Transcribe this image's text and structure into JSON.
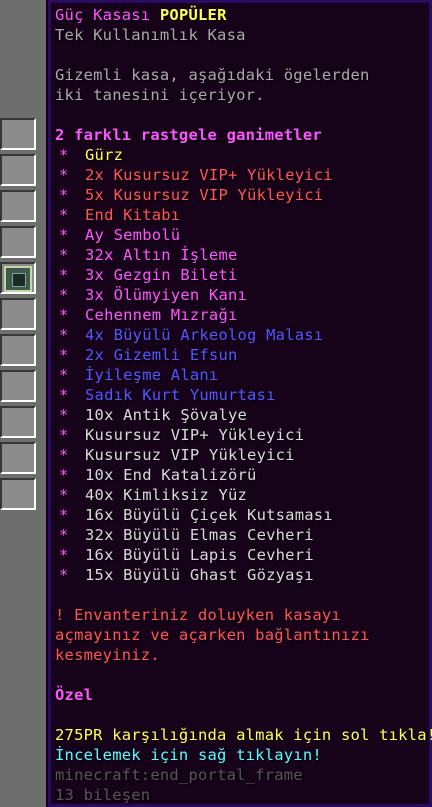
{
  "tooltip": {
    "title": "Güç Kasası",
    "badge": "POPÜLER",
    "subtitle": "Tek Kullanımlık Kasa",
    "description": [
      "Gizemli kasa, aşağıdaki ögelerden",
      "iki tanesini içeriyor."
    ],
    "rewards_header": "2 farklı rastgele ganimetler",
    "bullet": "*",
    "rewards": [
      {
        "text": "Gürz",
        "color": "#ffff55"
      },
      {
        "text": "2x Kusursuz VIP+ Yükleyici",
        "color": "#ff5555"
      },
      {
        "text": "5x Kusursuz VIP Yükleyici",
        "color": "#ff5555"
      },
      {
        "text": "End Kitabı",
        "color": "#ff5555"
      },
      {
        "text": "Ay Sembolü",
        "color": "#ff55ff"
      },
      {
        "text": "32x Altın İşleme",
        "color": "#ff55ff"
      },
      {
        "text": "3x Gezgin Bileti",
        "color": "#ff55ff"
      },
      {
        "text": "3x Ölümyiyen Kanı",
        "color": "#ff55ff"
      },
      {
        "text": "Cehennem Mızrağı",
        "color": "#ff55ff"
      },
      {
        "text": "4x Büyülü Arkeolog Malası",
        "color": "#5555ff"
      },
      {
        "text": "2x Gizemli Efsun",
        "color": "#5555ff"
      },
      {
        "text": "İyileşme Alanı",
        "color": "#5555ff"
      },
      {
        "text": "Sadık Kurt Yumurtası",
        "color": "#5555ff"
      },
      {
        "text": "10x Antik Şövalye",
        "color": "#d8d8d8"
      },
      {
        "text": "Kusursuz VIP+ Yükleyici",
        "color": "#d8d8d8"
      },
      {
        "text": "Kusursuz VIP Yükleyici",
        "color": "#d8d8d8"
      },
      {
        "text": "10x End Katalizörü",
        "color": "#d8d8d8"
      },
      {
        "text": "40x Kimliksiz Yüz",
        "color": "#d8d8d8"
      },
      {
        "text": "16x Büyülü Çiçek Kutsaması",
        "color": "#d8d8d8"
      },
      {
        "text": "32x Büyülü Elmas Cevheri",
        "color": "#d8d8d8"
      },
      {
        "text": "16x Büyülü Lapis Cevheri",
        "color": "#d8d8d8"
      },
      {
        "text": "15x Büyülü Ghast Gözyaşı",
        "color": "#d8d8d8"
      }
    ],
    "warning": [
      "! Envanteriniz doluyken kasayı",
      "açmayınız ve açarken bağlantınızı",
      "kesmeyiniz."
    ],
    "special_label": "Özel",
    "buy_action": "275PR karşılığında almak için sol tıkla!",
    "inspect_action": "İncelemek için sağ tıklayın!",
    "item_id": "minecraft:end_portal_frame",
    "component_count": "13 bileşen"
  },
  "colors": {
    "tooltip_bg": "#16031a",
    "tooltip_border": "#2a0b63",
    "pink": "#ff55ff",
    "yellow": "#ffff55",
    "red": "#ff5555",
    "blue": "#5555ff",
    "aqua": "#55ffff",
    "gray": "#a8a8a8",
    "dark_gray": "#555555"
  }
}
